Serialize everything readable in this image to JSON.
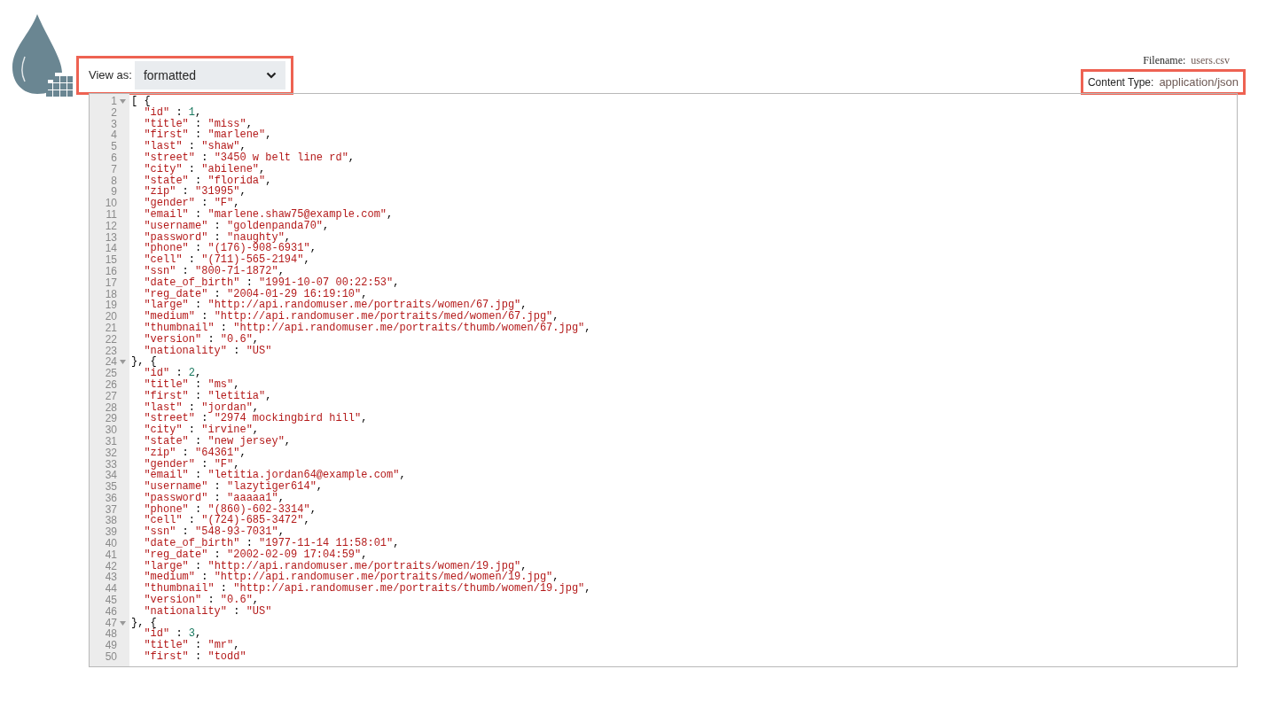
{
  "view_as": {
    "label": "View as:",
    "value": "formatted"
  },
  "file_info": {
    "filename_label": "Filename:",
    "filename": "users.csv",
    "content_type_label": "Content Type:",
    "content_type": "application/json"
  },
  "editor": {
    "lines": [
      {
        "number": "1",
        "foldable": true,
        "text": "[ {"
      },
      {
        "number": "2",
        "foldable": false,
        "text": "  \"id\" : 1,"
      },
      {
        "number": "3",
        "foldable": false,
        "text": "  \"title\" : \"miss\","
      },
      {
        "number": "4",
        "foldable": false,
        "text": "  \"first\" : \"marlene\","
      },
      {
        "number": "5",
        "foldable": false,
        "text": "  \"last\" : \"shaw\","
      },
      {
        "number": "6",
        "foldable": false,
        "text": "  \"street\" : \"3450 w belt line rd\","
      },
      {
        "number": "7",
        "foldable": false,
        "text": "  \"city\" : \"abilene\","
      },
      {
        "number": "8",
        "foldable": false,
        "text": "  \"state\" : \"florida\","
      },
      {
        "number": "9",
        "foldable": false,
        "text": "  \"zip\" : \"31995\","
      },
      {
        "number": "10",
        "foldable": false,
        "text": "  \"gender\" : \"F\","
      },
      {
        "number": "11",
        "foldable": false,
        "text": "  \"email\" : \"marlene.shaw75@example.com\","
      },
      {
        "number": "12",
        "foldable": false,
        "text": "  \"username\" : \"goldenpanda70\","
      },
      {
        "number": "13",
        "foldable": false,
        "text": "  \"password\" : \"naughty\","
      },
      {
        "number": "14",
        "foldable": false,
        "text": "  \"phone\" : \"(176)-908-6931\","
      },
      {
        "number": "15",
        "foldable": false,
        "text": "  \"cell\" : \"(711)-565-2194\","
      },
      {
        "number": "16",
        "foldable": false,
        "text": "  \"ssn\" : \"800-71-1872\","
      },
      {
        "number": "17",
        "foldable": false,
        "text": "  \"date_of_birth\" : \"1991-10-07 00:22:53\","
      },
      {
        "number": "18",
        "foldable": false,
        "text": "  \"reg_date\" : \"2004-01-29 16:19:10\","
      },
      {
        "number": "19",
        "foldable": false,
        "text": "  \"large\" : \"http://api.randomuser.me/portraits/women/67.jpg\","
      },
      {
        "number": "20",
        "foldable": false,
        "text": "  \"medium\" : \"http://api.randomuser.me/portraits/med/women/67.jpg\","
      },
      {
        "number": "21",
        "foldable": false,
        "text": "  \"thumbnail\" : \"http://api.randomuser.me/portraits/thumb/women/67.jpg\","
      },
      {
        "number": "22",
        "foldable": false,
        "text": "  \"version\" : \"0.6\","
      },
      {
        "number": "23",
        "foldable": false,
        "text": "  \"nationality\" : \"US\""
      },
      {
        "number": "24",
        "foldable": true,
        "text": "}, {"
      },
      {
        "number": "25",
        "foldable": false,
        "text": "  \"id\" : 2,"
      },
      {
        "number": "26",
        "foldable": false,
        "text": "  \"title\" : \"ms\","
      },
      {
        "number": "27",
        "foldable": false,
        "text": "  \"first\" : \"letitia\","
      },
      {
        "number": "28",
        "foldable": false,
        "text": "  \"last\" : \"jordan\","
      },
      {
        "number": "29",
        "foldable": false,
        "text": "  \"street\" : \"2974 mockingbird hill\","
      },
      {
        "number": "30",
        "foldable": false,
        "text": "  \"city\" : \"irvine\","
      },
      {
        "number": "31",
        "foldable": false,
        "text": "  \"state\" : \"new jersey\","
      },
      {
        "number": "32",
        "foldable": false,
        "text": "  \"zip\" : \"64361\","
      },
      {
        "number": "33",
        "foldable": false,
        "text": "  \"gender\" : \"F\","
      },
      {
        "number": "34",
        "foldable": false,
        "text": "  \"email\" : \"letitia.jordan64@example.com\","
      },
      {
        "number": "35",
        "foldable": false,
        "text": "  \"username\" : \"lazytiger614\","
      },
      {
        "number": "36",
        "foldable": false,
        "text": "  \"password\" : \"aaaaa1\","
      },
      {
        "number": "37",
        "foldable": false,
        "text": "  \"phone\" : \"(860)-602-3314\","
      },
      {
        "number": "38",
        "foldable": false,
        "text": "  \"cell\" : \"(724)-685-3472\","
      },
      {
        "number": "39",
        "foldable": false,
        "text": "  \"ssn\" : \"548-93-7031\","
      },
      {
        "number": "40",
        "foldable": false,
        "text": "  \"date_of_birth\" : \"1977-11-14 11:58:01\","
      },
      {
        "number": "41",
        "foldable": false,
        "text": "  \"reg_date\" : \"2002-02-09 17:04:59\","
      },
      {
        "number": "42",
        "foldable": false,
        "text": "  \"large\" : \"http://api.randomuser.me/portraits/women/19.jpg\","
      },
      {
        "number": "43",
        "foldable": false,
        "text": "  \"medium\" : \"http://api.randomuser.me/portraits/med/women/19.jpg\","
      },
      {
        "number": "44",
        "foldable": false,
        "text": "  \"thumbnail\" : \"http://api.randomuser.me/portraits/thumb/women/19.jpg\","
      },
      {
        "number": "45",
        "foldable": false,
        "text": "  \"version\" : \"0.6\","
      },
      {
        "number": "46",
        "foldable": false,
        "text": "  \"nationality\" : \"US\""
      },
      {
        "number": "47",
        "foldable": true,
        "text": "}, {"
      },
      {
        "number": "48",
        "foldable": false,
        "text": "  \"id\" : 3,"
      },
      {
        "number": "49",
        "foldable": false,
        "text": "  \"title\" : \"mr\","
      },
      {
        "number": "50",
        "foldable": false,
        "text": "  \"first\" : \"todd\""
      }
    ]
  }
}
